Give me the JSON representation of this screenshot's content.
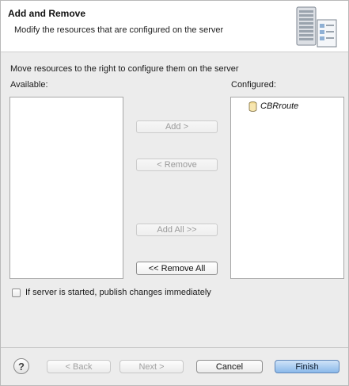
{
  "header": {
    "title": "Add and Remove",
    "description": "Modify the resources that are configured on the server",
    "graphic": "server-document-icon"
  },
  "instruction": "Move resources to the right to configure them on the server",
  "available": {
    "label": "Available:",
    "items": []
  },
  "configured": {
    "label": "Configured:",
    "items": [
      {
        "name": "CBRroute",
        "icon": "database-icon"
      }
    ]
  },
  "buttons": {
    "add": "Add >",
    "remove": "< Remove",
    "add_all": "Add All >>",
    "remove_all": "<< Remove All"
  },
  "publish_checkbox": {
    "label": "If server is started, publish changes immediately",
    "checked": false
  },
  "footer": {
    "help_icon": "help-icon",
    "help_glyph": "?",
    "back": "< Back",
    "next": "Next >",
    "cancel": "Cancel",
    "finish": "Finish"
  },
  "colors": {
    "finish_button": "#8bb9ea",
    "header_background": "#ffffff",
    "dialog_background": "#ececec"
  }
}
